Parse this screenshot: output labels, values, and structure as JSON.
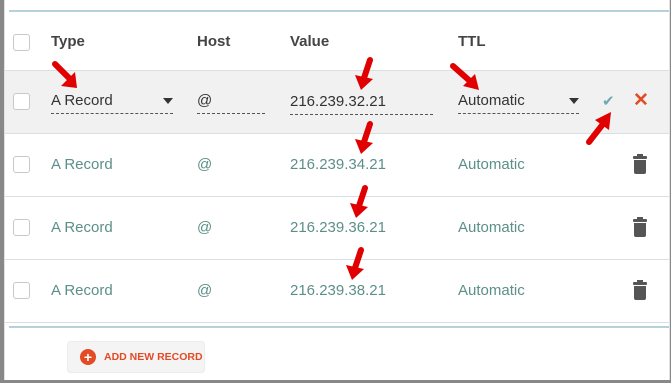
{
  "headers": {
    "type": "Type",
    "host": "Host",
    "value": "Value",
    "ttl": "TTL"
  },
  "edit_row": {
    "type": "A Record",
    "host": "@",
    "value": "216.239.32.21",
    "ttl": "Automatic"
  },
  "rows": [
    {
      "type": "A Record",
      "host": "@",
      "value": "216.239.34.21",
      "ttl": "Automatic"
    },
    {
      "type": "A Record",
      "host": "@",
      "value": "216.239.36.21",
      "ttl": "Automatic"
    },
    {
      "type": "A Record",
      "host": "@",
      "value": "216.239.38.21",
      "ttl": "Automatic"
    }
  ],
  "add_button": {
    "label": "ADD NEW RECORD"
  },
  "icons": {
    "confirm": "checkmark-icon",
    "cancel": "close-icon",
    "delete": "trash-icon",
    "add": "plus-circle-icon"
  },
  "colors": {
    "accent": "#e34b26",
    "link_text": "#5c8f89",
    "arrow": "#e00000",
    "rule": "#b7d1d8"
  }
}
